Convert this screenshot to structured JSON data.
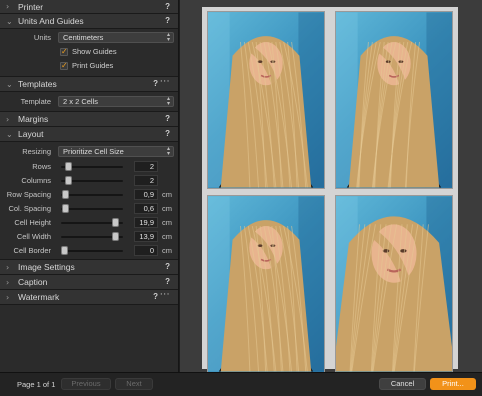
{
  "panel": {
    "sections": {
      "printer": {
        "title": "Printer"
      },
      "units": {
        "title": "Units And Guides"
      },
      "templates": {
        "title": "Templates"
      },
      "margins": {
        "title": "Margins"
      },
      "layout": {
        "title": "Layout"
      },
      "image_settings": {
        "title": "Image Settings"
      },
      "caption": {
        "title": "Caption"
      },
      "watermark": {
        "title": "Watermark"
      }
    },
    "help_glyph": "?",
    "more_glyph": "···",
    "units": {
      "label": "Units",
      "value": "Centimeters",
      "show_guides": {
        "label": "Show Guides",
        "checked": true
      },
      "print_guides": {
        "label": "Print Guides",
        "checked": true
      }
    },
    "templates": {
      "label": "Template",
      "value": "2 x 2 Cells"
    },
    "layout": {
      "resizing": {
        "label": "Resizing",
        "value": "Prioritize Cell Size"
      },
      "sliders": [
        {
          "label": "Rows",
          "value": "2",
          "unit": "",
          "level": 0.08
        },
        {
          "label": "Columns",
          "value": "2",
          "unit": "",
          "level": 0.08
        },
        {
          "label": "Row Spacing",
          "value": "0,9",
          "unit": "cm",
          "level": 0.02
        },
        {
          "label": "Col. Spacing",
          "value": "0,6",
          "unit": "cm",
          "level": 0.02
        },
        {
          "label": "Cell Height",
          "value": "19,9",
          "unit": "cm",
          "level": 0.93
        },
        {
          "label": "Cell Width",
          "value": "13,9",
          "unit": "cm",
          "level": 0.93
        },
        {
          "label": "Cell Border",
          "value": "0",
          "unit": "cm",
          "level": 0.0
        }
      ]
    }
  },
  "footer": {
    "page_info": "Page 1 of 1",
    "previous": "Previous",
    "next": "Next",
    "cancel": "Cancel",
    "print": "Print..."
  },
  "colors": {
    "accent": "#f29219",
    "sky": "#4aa6cf",
    "hair": "#c9a267"
  }
}
